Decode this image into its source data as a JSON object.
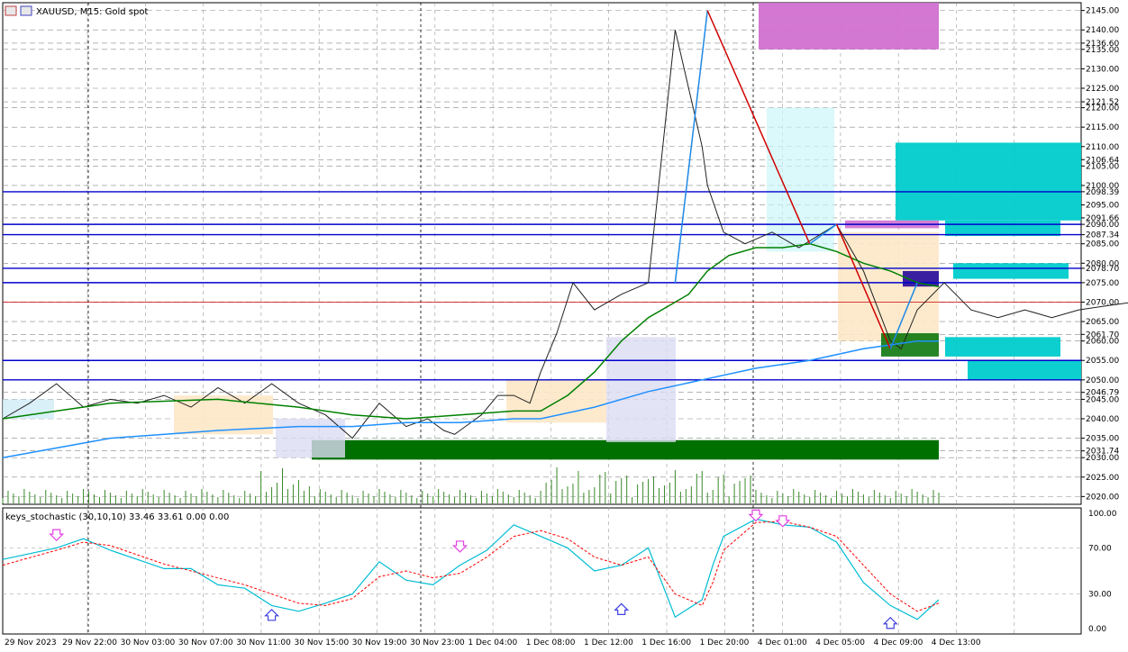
{
  "window": {
    "symbol_title": "XAUUSD, M15:  Gold spot",
    "indicator_title": "keys_stochastic (30,10,10) 33.46 33.61 0.00 0.00"
  },
  "colors": {
    "blue_line": "#0000cc",
    "red_line": "#cc0000",
    "ma_green": "#008000",
    "ma_cyan": "#1e90ff",
    "stoch_main": "#00bcd4",
    "stoch_signal": "#ff0000",
    "zone_magenta": "#d070d0",
    "zone_cyan": "#00cccc",
    "zone_green": "#007000",
    "zone_peach": "#fde8c8",
    "zone_lavender": "#dcdcf4"
  },
  "chart_data": [
    {
      "type": "line",
      "ylim": [
        2018,
        2147
      ],
      "yticks": [
        "2145.00",
        "2140.00",
        "2136.60",
        "2135.00",
        "2130.00",
        "2125.00",
        "2121.52",
        "2120.00",
        "2115.00",
        "2110.00",
        "2106.64",
        "2105.00",
        "2100.00",
        "2098.39",
        "2095.00",
        "2091.66",
        "2090.00",
        "2087.34",
        "2085.00",
        "2080.00",
        "2078.70",
        "2075.00",
        "2070.00",
        "2065.00",
        "2061.70",
        "2060.00",
        "2055.00",
        "2050.00",
        "2046.79",
        "2045.00",
        "2040.00",
        "2035.00",
        "2031.74",
        "2030.00",
        "2025.00",
        "2020.00"
      ],
      "xticks": [
        "29 Nov 2023",
        "29 Nov 22:00",
        "30 Nov 03:00",
        "30 Nov 07:00",
        "30 Nov 11:00",
        "30 Nov 15:00",
        "30 Nov 19:00",
        "30 Nov 23:00",
        "1 Dec 04:00",
        "1 Dec 08:00",
        "1 Dec 12:00",
        "1 Dec 16:00",
        "1 Dec 20:00",
        "4 Dec 01:00",
        "4 Dec 05:00",
        "4 Dec 09:00",
        "4 Dec 13:00"
      ],
      "horizontal_levels": [
        2098.39,
        2090.0,
        2087.34,
        2078.7,
        2075.0,
        2055.0,
        2050.0
      ],
      "current_price": 2070.0,
      "series": [
        {
          "kind": "close",
          "x": [
            0,
            10,
            20,
            30,
            40,
            50,
            60,
            70,
            80,
            90,
            100,
            110,
            120,
            130,
            140,
            150,
            158,
            164,
            168,
            172,
            178,
            184,
            190,
            196,
            200,
            206,
            212,
            220,
            230,
            240,
            250,
            260,
            262,
            268,
            276,
            286,
            296,
            310,
            320,
            330,
            334,
            340,
            350,
            360,
            370,
            380,
            390,
            400,
            410,
            420,
            430,
            440,
            450,
            460,
            470,
            480,
            490,
            500,
            510,
            520
          ],
          "values": [
            2040,
            2044,
            2049,
            2043,
            2045,
            2044,
            2046,
            2043,
            2048,
            2044,
            2049,
            2044,
            2041,
            2035,
            2044,
            2038,
            2040,
            2037,
            2036,
            2038,
            2041,
            2046,
            2046,
            2044,
            2052,
            2062,
            2075,
            2068,
            2072,
            2075,
            2140,
            2110,
            2100,
            2088,
            2085,
            2088,
            2084,
            2090,
            2078,
            2060,
            2058,
            2068,
            2075,
            2068,
            2066,
            2068,
            2066,
            2068,
            2069,
            2070,
            2070,
            2070,
            2070,
            2070,
            2070,
            2070,
            2070,
            2070,
            2070,
            2070
          ]
        },
        {
          "kind": "ma_green",
          "x": [
            0,
            40,
            80,
            110,
            130,
            150,
            170,
            190,
            200,
            210,
            220,
            230,
            240,
            250,
            255,
            262,
            270,
            280,
            290,
            300,
            310,
            320,
            330,
            340,
            348
          ],
          "values": [
            2040,
            2044,
            2045,
            2043,
            2041,
            2040,
            2041,
            2042,
            2042,
            2046,
            2052,
            2060,
            2066,
            2070,
            2072,
            2078,
            2082,
            2084,
            2084,
            2085,
            2083,
            2080,
            2078,
            2075,
            2074
          ]
        },
        {
          "kind": "ma_cyan",
          "x": [
            0,
            40,
            80,
            110,
            130,
            150,
            170,
            190,
            200,
            220,
            240,
            260,
            280,
            300,
            320,
            330,
            340,
            348
          ],
          "values": [
            2030,
            2035,
            2037,
            2038,
            2038,
            2039,
            2039,
            2040,
            2040,
            2043,
            2047,
            2050,
            2053,
            2055,
            2058,
            2059,
            2060,
            2060
          ]
        }
      ]
    },
    {
      "type": "line",
      "ylim": [
        0,
        100
      ],
      "yticks": [
        "100.00",
        "70.00",
        "30.00",
        "0.00"
      ],
      "series": [
        {
          "kind": "main",
          "x": [
            0,
            20,
            30,
            40,
            50,
            60,
            70,
            80,
            90,
            100,
            110,
            120,
            130,
            140,
            150,
            160,
            170,
            180,
            190,
            200,
            210,
            220,
            230,
            240,
            250,
            260,
            264,
            268,
            280,
            290,
            300,
            310,
            320,
            330,
            340,
            348
          ],
          "values": [
            60,
            70,
            78,
            68,
            60,
            52,
            52,
            38,
            35,
            20,
            15,
            22,
            30,
            58,
            42,
            38,
            55,
            68,
            90,
            80,
            70,
            50,
            55,
            70,
            10,
            25,
            55,
            80,
            95,
            90,
            88,
            75,
            40,
            20,
            8,
            25
          ]
        },
        {
          "kind": "signal",
          "x": [
            0,
            20,
            30,
            40,
            50,
            60,
            70,
            80,
            90,
            100,
            110,
            120,
            130,
            140,
            150,
            160,
            170,
            180,
            190,
            200,
            210,
            220,
            230,
            240,
            250,
            260,
            264,
            268,
            280,
            290,
            300,
            310,
            320,
            330,
            340,
            348
          ],
          "values": [
            55,
            68,
            75,
            72,
            64,
            56,
            50,
            44,
            38,
            30,
            22,
            20,
            26,
            45,
            50,
            44,
            48,
            62,
            80,
            85,
            78,
            62,
            55,
            62,
            30,
            20,
            40,
            68,
            92,
            93,
            88,
            80,
            55,
            30,
            15,
            22
          ]
        }
      ]
    }
  ]
}
